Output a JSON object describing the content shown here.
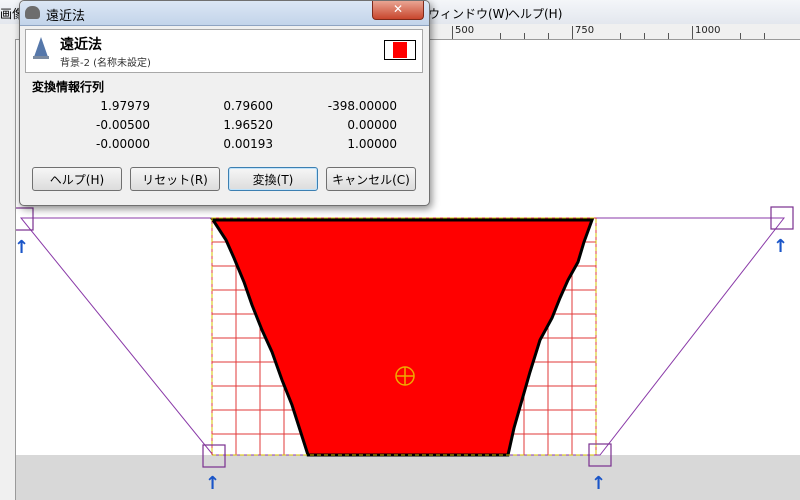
{
  "menubar": {
    "items": [
      "画像",
      "ウィンドウ(W)",
      "ヘルプ(H)"
    ]
  },
  "ruler": {
    "labels": [
      "500",
      "750",
      "1000"
    ]
  },
  "dialog": {
    "title": "遠近法",
    "close_symbol": "✕",
    "tool_name": "遠近法",
    "layer_info": "背景-2 (名称未設定)",
    "section_title": "変換情報行列",
    "matrix": [
      [
        "1.97979",
        "0.79600",
        "-398.00000"
      ],
      [
        "-0.00500",
        "1.96520",
        "0.00000"
      ],
      [
        "-0.00000",
        "0.00193",
        "1.00000"
      ]
    ],
    "buttons": {
      "help": "ヘルプ(H)",
      "reset": "リセット(R)",
      "transform": "変換(T)",
      "cancel": "キャンセル(C)"
    }
  },
  "canvas": {
    "arrow_symbol": "↑",
    "fill_color": "#ff0000",
    "grid_color": "#e23a3a",
    "handle_color": "#7a3090",
    "arrow_color": "#1a55c8"
  }
}
